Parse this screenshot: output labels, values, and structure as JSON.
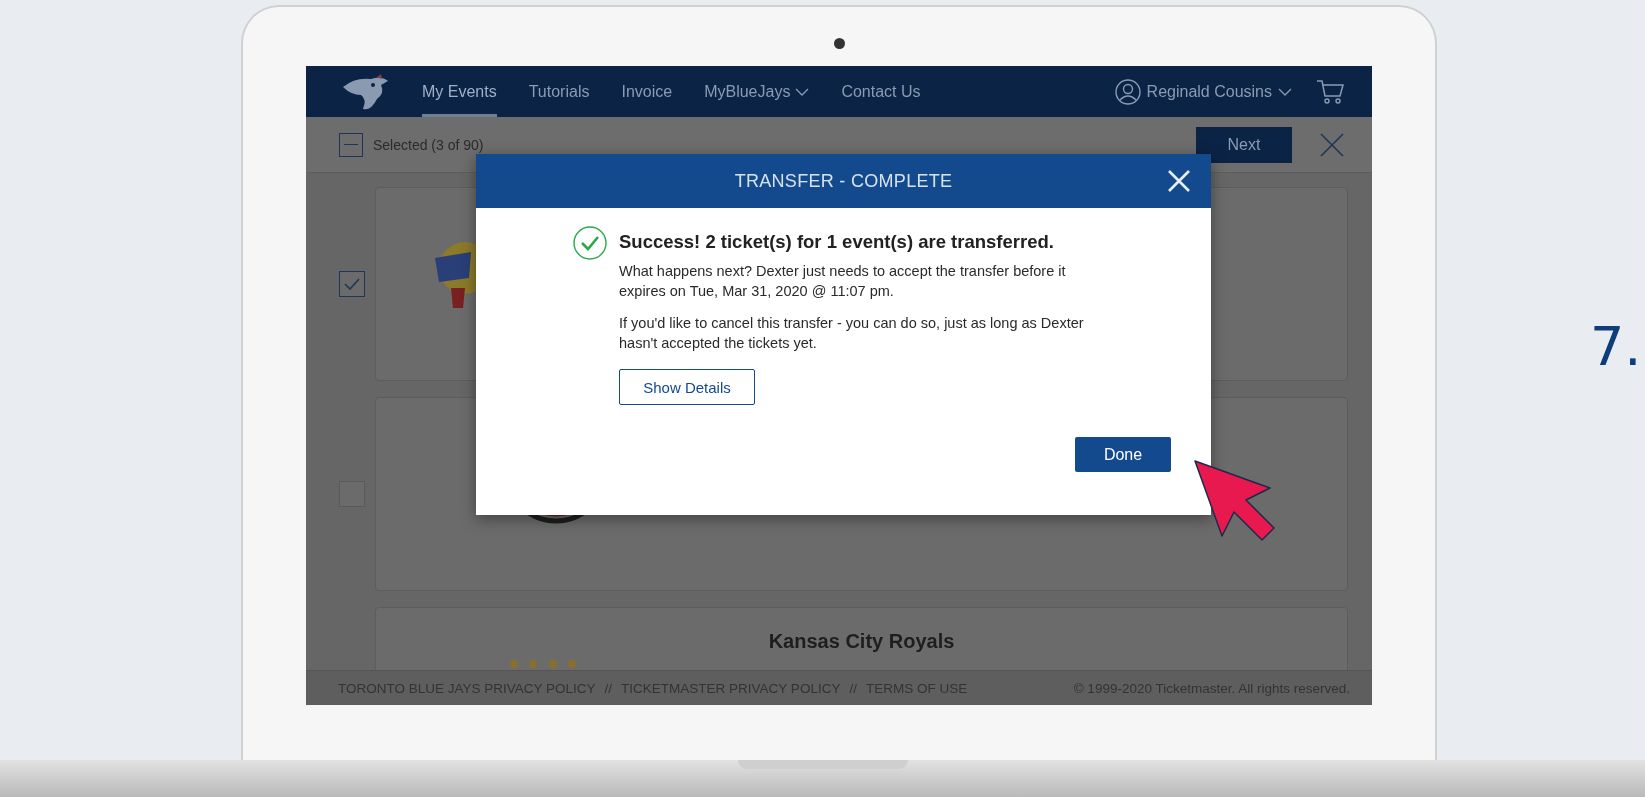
{
  "step": "7.",
  "nav": {
    "items": [
      {
        "label": "My Events",
        "selected": true,
        "dropdown": false
      },
      {
        "label": "Tutorials",
        "selected": false,
        "dropdown": false
      },
      {
        "label": "Invoice",
        "selected": false,
        "dropdown": false
      },
      {
        "label": "MyBlueJays",
        "selected": false,
        "dropdown": true
      },
      {
        "label": "Contact Us",
        "selected": false,
        "dropdown": false
      }
    ],
    "user": "Reginald Cousins"
  },
  "toolbar": {
    "indeterminate": true,
    "selection": "Selected (3 of 90)",
    "next": "Next"
  },
  "events": [
    {
      "kind": "badge",
      "checked": true
    },
    {
      "kind": "ring",
      "checked": false
    },
    {
      "kind": "crown",
      "title": "Kansas City Royals"
    }
  ],
  "modal": {
    "title": "TRANSFER - COMPLETE",
    "heading": "Success! 2 ticket(s) for 1 event(s) are transferred.",
    "paragraphs": [
      "What happens next? Dexter just needs to accept the transfer before it expires on Tue, Mar 31, 2020 @ 11:07 pm.",
      "If you'd like to cancel this transfer - you can do so, just as long as Dexter hasn't accepted the tickets yet."
    ],
    "details_button": "Show Details",
    "done_button": "Done"
  },
  "footer": {
    "links": [
      "TORONTO BLUE JAYS PRIVACY POLICY",
      "TICKETMASTER PRIVACY POLICY",
      "TERMS OF USE"
    ],
    "separators": [
      "//",
      "//"
    ],
    "copyright": "© 1999-2020 Ticketmaster. All rights reserved."
  }
}
